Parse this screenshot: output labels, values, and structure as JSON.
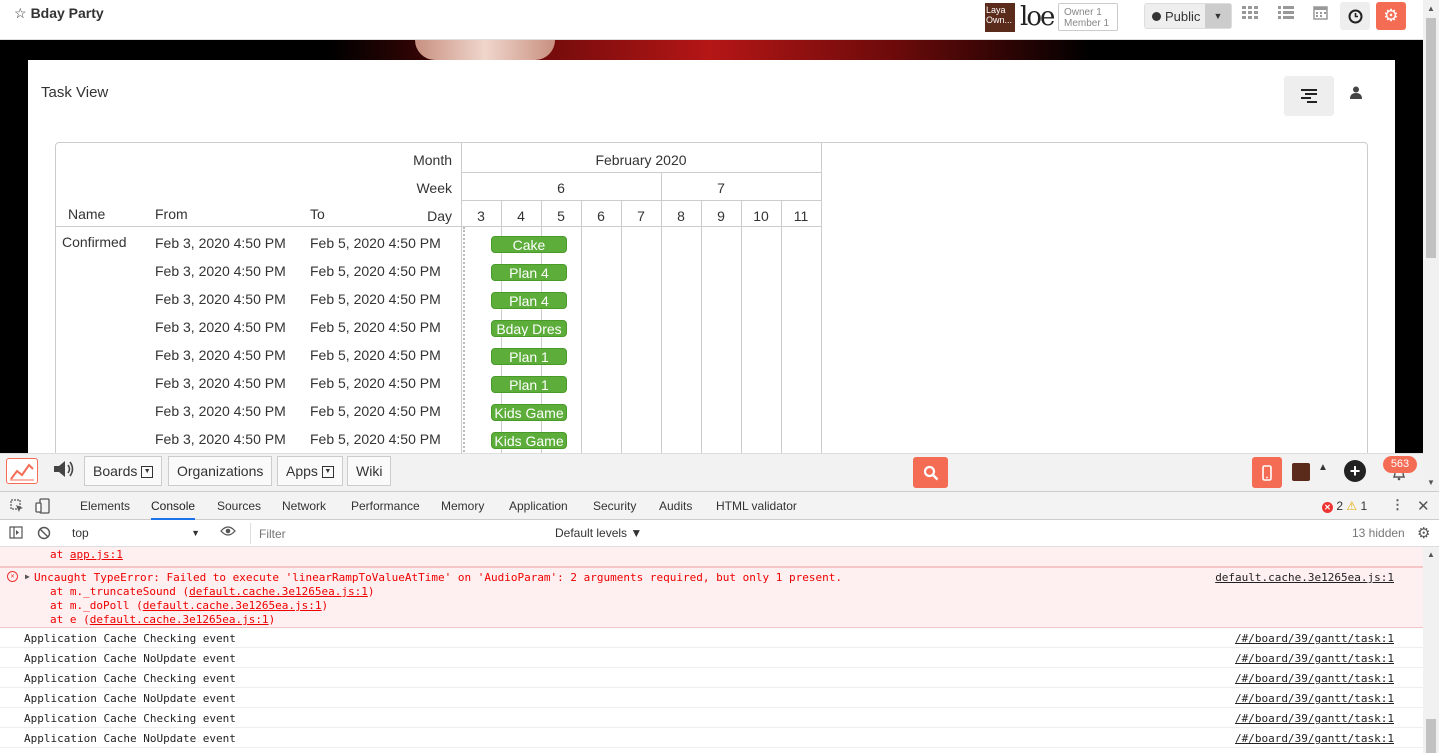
{
  "header": {
    "board_title": "Bday Party",
    "star": "☆",
    "avatar_text": "Laya Own...",
    "logo_text": "loe",
    "owner_label": "Owner 1",
    "member_label": "Member 1",
    "visibility": "Public"
  },
  "panel": {
    "title": "Task View"
  },
  "gantt": {
    "labels": {
      "month": "Month",
      "week": "Week",
      "day": "Day"
    },
    "columns": {
      "name": "Name",
      "from": "From",
      "to": "To"
    },
    "month": "February 2020",
    "weeks": [
      {
        "label": "6",
        "days": 5
      },
      {
        "label": "7",
        "days": 3
      }
    ],
    "days": [
      "3",
      "4",
      "5",
      "6",
      "7",
      "8",
      "9",
      "10",
      "11"
    ],
    "rows": [
      {
        "name": "Confirmed",
        "from": "Feb 3, 2020 4:50 PM",
        "to": "Feb 5, 2020 4:50 PM",
        "task": "Cake"
      },
      {
        "name": "",
        "from": "Feb 3, 2020 4:50 PM",
        "to": "Feb 5, 2020 4:50 PM",
        "task": "Plan 4"
      },
      {
        "name": "",
        "from": "Feb 3, 2020 4:50 PM",
        "to": "Feb 5, 2020 4:50 PM",
        "task": "Plan 4"
      },
      {
        "name": "",
        "from": "Feb 3, 2020 4:50 PM",
        "to": "Feb 5, 2020 4:50 PM",
        "task": "Bday Dres"
      },
      {
        "name": "",
        "from": "Feb 3, 2020 4:50 PM",
        "to": "Feb 5, 2020 4:50 PM",
        "task": "Plan 1"
      },
      {
        "name": "",
        "from": "Feb 3, 2020 4:50 PM",
        "to": "Feb 5, 2020 4:50 PM",
        "task": "Plan 1"
      },
      {
        "name": "",
        "from": "Feb 3, 2020 4:50 PM",
        "to": "Feb 5, 2020 4:50 PM",
        "task": "Kids Game"
      },
      {
        "name": "",
        "from": "Feb 3, 2020 4:50 PM",
        "to": "Feb 5, 2020 4:50 PM",
        "task": "Kids Game"
      }
    ],
    "bar_color": "#5cad3a"
  },
  "dock": {
    "boards": "Boards",
    "organizations": "Organizations",
    "apps": "Apps",
    "wiki": "Wiki",
    "notification_count": "563",
    "accent_color": "#f56c55"
  },
  "devtools": {
    "tabs": [
      "Elements",
      "Console",
      "Sources",
      "Network",
      "Performance",
      "Memory",
      "Application",
      "Security",
      "Audits",
      "HTML validator"
    ],
    "active_tab": "Console",
    "error_count": "2",
    "warning_count": "1",
    "context": "top",
    "filter_placeholder": "Filter",
    "levels": "Default levels ▼",
    "hidden": "13 hidden",
    "partial_line": "at app.js:1",
    "error": {
      "message": "Uncaught TypeError: Failed to execute 'linearRampToValueAtTime' on 'AudioParam': 2 arguments required, but only 1 present.",
      "source": "default.cache.3e1265ea.js:1",
      "stack": [
        {
          "fn": "at m._truncateSound (",
          "file": "default.cache.3e1265ea.js:1",
          "end": ")"
        },
        {
          "fn": "at m._doPoll (",
          "file": "default.cache.3e1265ea.js:1",
          "end": ")"
        },
        {
          "fn": "at e (",
          "file": "default.cache.3e1265ea.js:1",
          "end": ")"
        }
      ]
    },
    "logs": [
      {
        "msg": "Application Cache Checking event",
        "src": "/#/board/39/gantt/task:1"
      },
      {
        "msg": "Application Cache NoUpdate event",
        "src": "/#/board/39/gantt/task:1"
      },
      {
        "msg": "Application Cache Checking event",
        "src": "/#/board/39/gantt/task:1"
      },
      {
        "msg": "Application Cache NoUpdate event",
        "src": "/#/board/39/gantt/task:1"
      },
      {
        "msg": "Application Cache Checking event",
        "src": "/#/board/39/gantt/task:1"
      },
      {
        "msg": "Application Cache NoUpdate event",
        "src": "/#/board/39/gantt/task:1"
      }
    ]
  }
}
